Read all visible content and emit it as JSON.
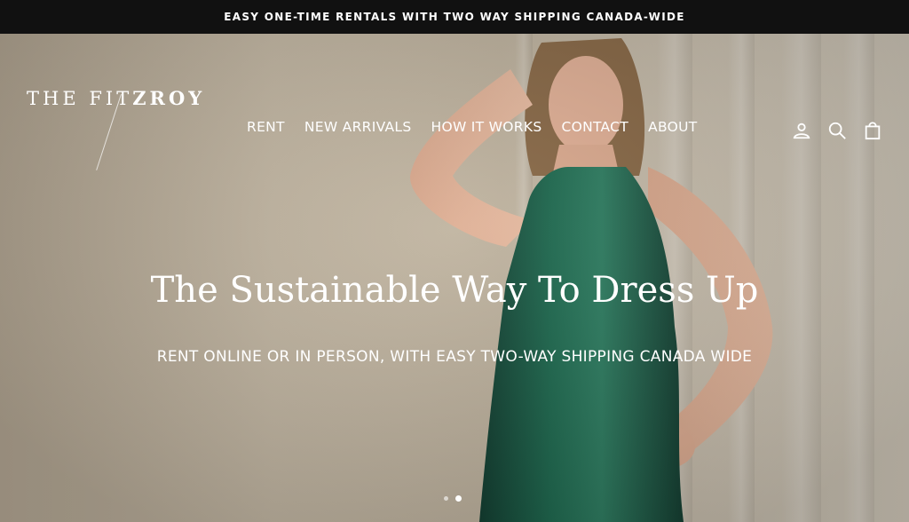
{
  "announcement": "EASY ONE-TIME RENTALS WITH TWO WAY SHIPPING CANADA-WIDE",
  "logo": {
    "thin": "THE FIT",
    "bold": "ZROY"
  },
  "nav": [
    {
      "label": "RENT"
    },
    {
      "label": "NEW ARRIVALS"
    },
    {
      "label": "HOW IT WORKS"
    },
    {
      "label": "CONTACT"
    },
    {
      "label": "ABOUT"
    }
  ],
  "icons": [
    "account-icon",
    "search-icon",
    "cart-icon"
  ],
  "hero": {
    "title": "The Sustainable Way To Dress Up",
    "subtitle": "RENT ONLINE OR IN PERSON, WITH EASY TWO-WAY SHIPPING CANADA WIDE"
  },
  "slides": {
    "count": 2,
    "active": 2
  },
  "colors": {
    "dress": "#1f5a45",
    "background": "#c2b6a2",
    "bar": "#111111"
  }
}
